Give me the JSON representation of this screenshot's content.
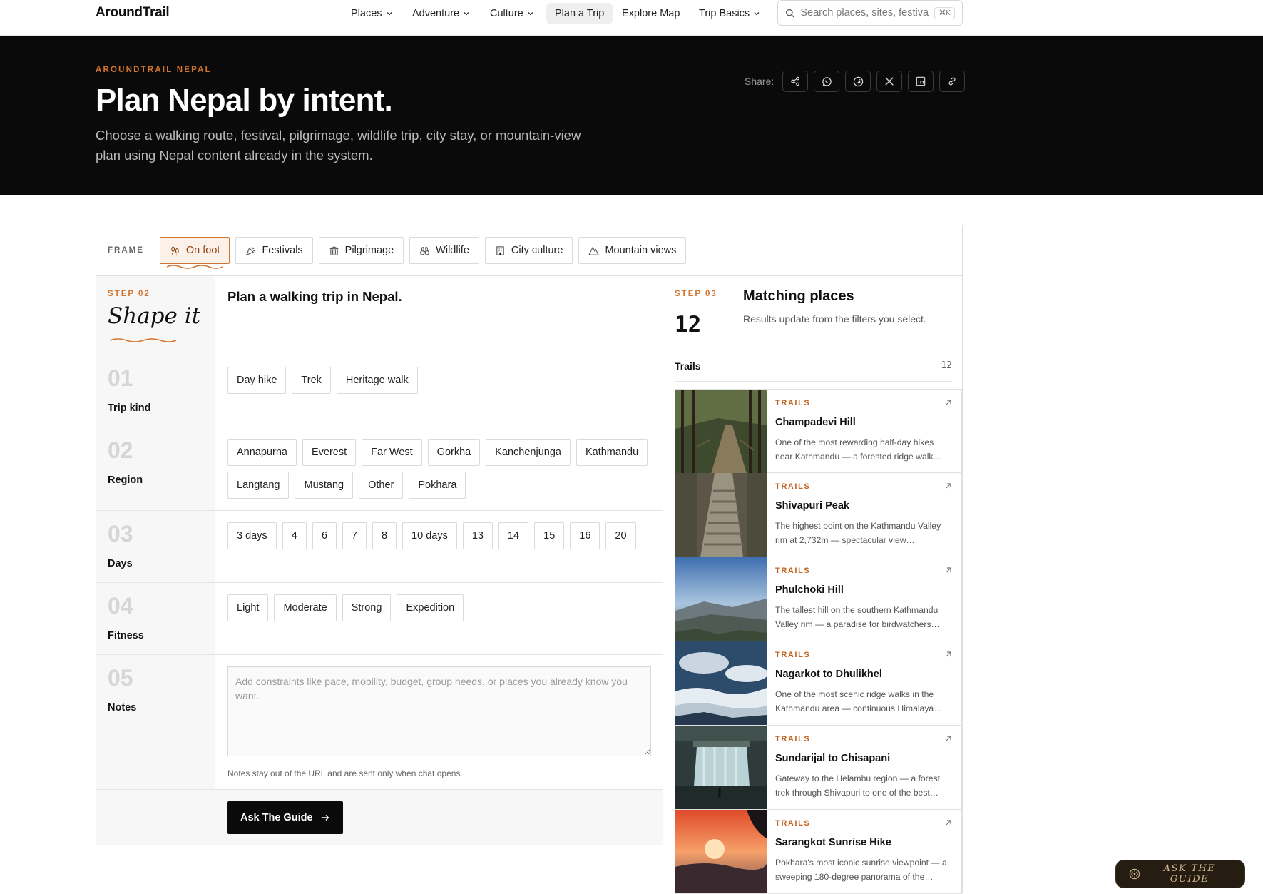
{
  "nav": {
    "logo": "AroundTrail",
    "items": [
      {
        "label": "Places",
        "dropdown": true
      },
      {
        "label": "Adventure",
        "dropdown": true
      },
      {
        "label": "Culture",
        "dropdown": true
      },
      {
        "label": "Plan a Trip",
        "dropdown": false,
        "active": true
      },
      {
        "label": "Explore Map",
        "dropdown": false
      },
      {
        "label": "Trip Basics",
        "dropdown": true
      }
    ],
    "search_placeholder": "Search places, sites, festivals",
    "search_shortcut": "⌘K"
  },
  "hero": {
    "eyebrow": "AROUNDTRAIL NEPAL",
    "title": "Plan Nepal by intent.",
    "subtitle": "Choose a walking route, festival, pilgrimage, wildlife trip, city stay, or mountain-view plan using Nepal content already in the system.",
    "share_label": "Share:",
    "share_icons": [
      "share-icon",
      "whatsapp-icon",
      "facebook-icon",
      "x-icon",
      "linkedin-icon",
      "link-icon"
    ]
  },
  "frame": {
    "label": "FRAME",
    "chips": [
      {
        "label": "On foot",
        "icon": "footprints-icon",
        "active": true
      },
      {
        "label": "Festivals",
        "icon": "party-icon"
      },
      {
        "label": "Pilgrimage",
        "icon": "temple-icon"
      },
      {
        "label": "Wildlife",
        "icon": "binoculars-icon"
      },
      {
        "label": "City culture",
        "icon": "building-icon"
      },
      {
        "label": "Mountain views",
        "icon": "mountain-icon"
      }
    ]
  },
  "shape": {
    "eyebrow": "STEP 02",
    "title": "Shape it",
    "heading": "Plan a walking trip in Nepal."
  },
  "sections": {
    "trip_kind": {
      "num": "01",
      "title": "Trip kind",
      "options": [
        "Day hike",
        "Trek",
        "Heritage walk"
      ]
    },
    "region": {
      "num": "02",
      "title": "Region",
      "options": [
        "Annapurna",
        "Everest",
        "Far West",
        "Gorkha",
        "Kanchenjunga",
        "Kathmandu",
        "Langtang",
        "Mustang",
        "Other",
        "Pokhara"
      ]
    },
    "days": {
      "num": "03",
      "title": "Days",
      "options": [
        "3 days",
        "4",
        "6",
        "7",
        "8",
        "10 days",
        "13",
        "14",
        "15",
        "16",
        "20"
      ]
    },
    "fitness": {
      "num": "04",
      "title": "Fitness",
      "options": [
        "Light",
        "Moderate",
        "Strong",
        "Expedition"
      ]
    },
    "notes": {
      "num": "05",
      "title": "Notes",
      "placeholder": "Add constraints like pace, mobility, budget, group needs, or places you already know you want.",
      "help": "Notes stay out of the URL and are sent only when chat opens."
    }
  },
  "ask_button": "Ask The Guide",
  "results": {
    "eyebrow": "STEP 03",
    "count": "12",
    "title": "Matching places",
    "subtitle": "Results update from the filters you select.",
    "group_label": "Trails",
    "group_count": "12",
    "cards": [
      {
        "tag": "TRAILS",
        "title": "Champadevi Hill",
        "desc": "One of the most rewarding half-day hikes near Kathmandu — a forested ridge walk…"
      },
      {
        "tag": "TRAILS",
        "title": "Shivapuri Peak",
        "desc": "The highest point on the Kathmandu Valley rim at 2,732m — spectacular view…"
      },
      {
        "tag": "TRAILS",
        "title": "Phulchoki Hill",
        "desc": "The tallest hill on the southern Kathmandu Valley rim — a paradise for birdwatchers…"
      },
      {
        "tag": "TRAILS",
        "title": "Nagarkot to Dhulikhel",
        "desc": "One of the most scenic ridge walks in the Kathmandu area — continuous Himalaya…"
      },
      {
        "tag": "TRAILS",
        "title": "Sundarijal to Chisapani",
        "desc": "Gateway to the Helambu region — a forest trek through Shivapuri to one of the best…"
      },
      {
        "tag": "TRAILS",
        "title": "Sarangkot Sunrise Hike",
        "desc": "Pokhara's most iconic sunrise viewpoint — a sweeping 180-degree panorama of the…"
      }
    ]
  },
  "floating_button": "ASK THE GUIDE"
}
